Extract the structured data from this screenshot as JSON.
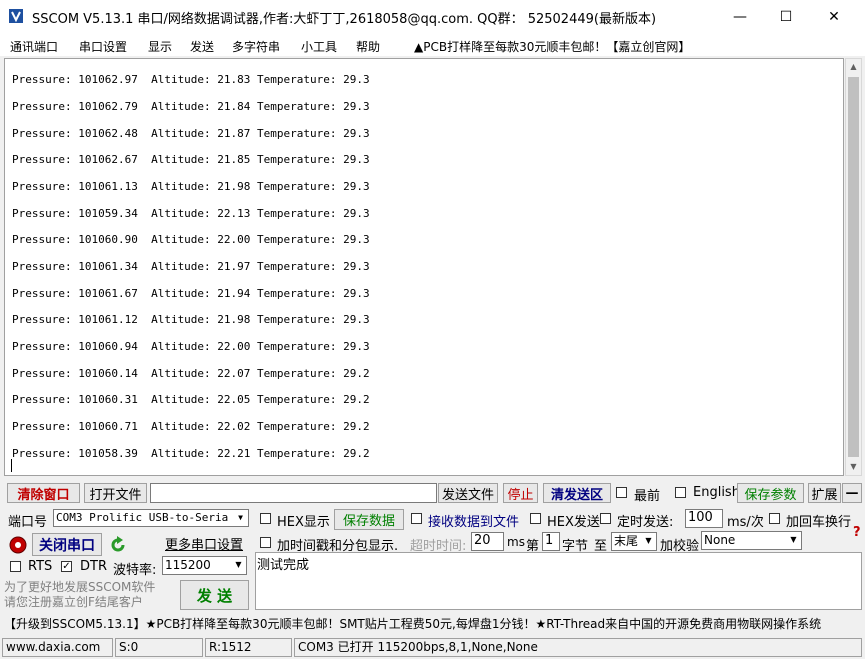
{
  "window": {
    "title": "SSCOM V5.13.1 串口/网络数据调试器,作者:大虾丁丁,2618058@qq.com. QQ群： 52502449(最新版本)",
    "icon": "app-icon",
    "controls": {
      "minimize": "—",
      "maximize": "☐",
      "close": "✕"
    }
  },
  "menu": {
    "items": [
      "通讯端口",
      "串口设置",
      "显示",
      "发送",
      "多字符串",
      "小工具",
      "帮助"
    ],
    "ad": "▲PCB打样降至每款30元顺丰包邮！【嘉立创官网】"
  },
  "receive": {
    "lines": [
      "Pressure: 101062.97  Altitude: 21.83 Temperature: 29.3",
      "Pressure: 101062.79  Altitude: 21.84 Temperature: 29.3",
      "Pressure: 101062.48  Altitude: 21.87 Temperature: 29.3",
      "Pressure: 101062.67  Altitude: 21.85 Temperature: 29.3",
      "Pressure: 101061.13  Altitude: 21.98 Temperature: 29.3",
      "Pressure: 101059.34  Altitude: 22.13 Temperature: 29.3",
      "Pressure: 101060.90  Altitude: 22.00 Temperature: 29.3",
      "Pressure: 101061.34  Altitude: 21.97 Temperature: 29.3",
      "Pressure: 101061.67  Altitude: 21.94 Temperature: 29.3",
      "Pressure: 101061.12  Altitude: 21.98 Temperature: 29.3",
      "Pressure: 101060.94  Altitude: 22.00 Temperature: 29.3",
      "Pressure: 101060.14  Altitude: 22.07 Temperature: 29.2",
      "Pressure: 101060.31  Altitude: 22.05 Temperature: 29.2",
      "Pressure: 101060.71  Altitude: 22.02 Temperature: 29.2",
      "Pressure: 101058.39  Altitude: 22.21 Temperature: 29.2"
    ]
  },
  "toolbar": {
    "clear_window": "清除窗口",
    "open_file": "打开文件",
    "file_path": "",
    "send_file": "发送文件",
    "stop": "停止",
    "clear_send": "清发送区",
    "topmost": "最前",
    "english": "English",
    "save_params": "保存参数",
    "expand": "扩展",
    "collapse": "—"
  },
  "port": {
    "port_label": "端口号",
    "port_value": "COM3 Prolific USB-to-Seria",
    "close_port": "关闭串口",
    "more_settings": "更多串口设置",
    "rts": "RTS",
    "dtr": "DTR",
    "dtr_checked": true,
    "baud_label": "波特率:",
    "baud_value": "115200"
  },
  "options": {
    "hex_display": "HEX显示",
    "save_data": "保存数据",
    "recv_to_file": "接收数据到文件",
    "hex_send": "HEX发送",
    "timed_send": "定时发送:",
    "interval": "100",
    "interval_unit": "ms/次",
    "add_crlf": "加回车换行",
    "timestamp": "加时间戳和分包显示.",
    "timeout_label": "超时时间:",
    "timeout_value": "20",
    "timeout_unit": "ms",
    "nth_label": "第",
    "nth_value": "1",
    "byte_label": "字节",
    "to_label": "至",
    "end_value": "末尾",
    "checksum_label": "加校验",
    "checksum_value": "None"
  },
  "send": {
    "text": "测试完成",
    "send_button": "发 送",
    "promo": "为了更好地发展SSCOM软件\n请您注册嘉立创F结尾客户"
  },
  "ticker": "【升级到SSCOM5.13.1】★PCB打样降至每款30元顺丰包邮！SMT贴片工程费50元,每焊盘1分钱！★RT-Thread来自中国的开源免费商用物联网操作系统",
  "status": {
    "site": "www.daxia.com",
    "sent": "S:0",
    "received": "R:1512",
    "port_status": "COM3 已打开  115200bps,8,1,None,None"
  },
  "colors": {
    "red": "#c00000",
    "green": "#008000",
    "blue": "#000080"
  }
}
